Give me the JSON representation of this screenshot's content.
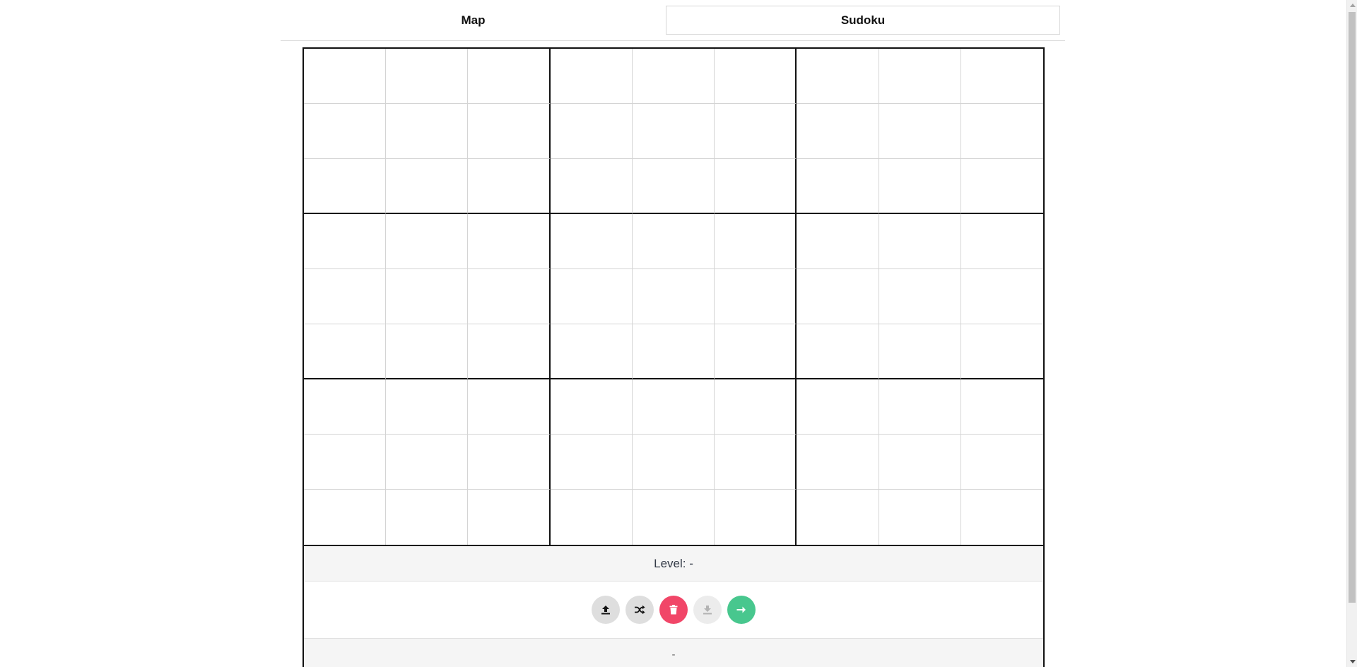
{
  "tabs": {
    "map_label": "Map",
    "sudoku_label": "Sudoku",
    "active": "Sudoku"
  },
  "board": {
    "size": 9,
    "cells": [
      [
        "",
        "",
        "",
        "",
        "",
        "",
        "",
        "",
        ""
      ],
      [
        "",
        "",
        "",
        "",
        "",
        "",
        "",
        "",
        ""
      ],
      [
        "",
        "",
        "",
        "",
        "",
        "",
        "",
        "",
        ""
      ],
      [
        "",
        "",
        "",
        "",
        "",
        "",
        "",
        "",
        ""
      ],
      [
        "",
        "",
        "",
        "",
        "",
        "",
        "",
        "",
        ""
      ],
      [
        "",
        "",
        "",
        "",
        "",
        "",
        "",
        "",
        ""
      ],
      [
        "",
        "",
        "",
        "",
        "",
        "",
        "",
        "",
        ""
      ],
      [
        "",
        "",
        "",
        "",
        "",
        "",
        "",
        "",
        ""
      ],
      [
        "",
        "",
        "",
        "",
        "",
        "",
        "",
        "",
        ""
      ]
    ]
  },
  "panel": {
    "level_label": "Level:",
    "level_value": "-",
    "status_text": "-"
  },
  "controls": [
    {
      "name": "upload-button",
      "icon": "upload-icon",
      "color": "#dedede"
    },
    {
      "name": "shuffle-button",
      "icon": "shuffle-icon",
      "color": "#dedede"
    },
    {
      "name": "delete-button",
      "icon": "trash-icon",
      "color": "#f14668"
    },
    {
      "name": "download-button",
      "icon": "download-icon",
      "color": "#ececec",
      "disabled": true
    },
    {
      "name": "next-button",
      "icon": "arrow-right-icon",
      "color": "#48c78e"
    }
  ]
}
